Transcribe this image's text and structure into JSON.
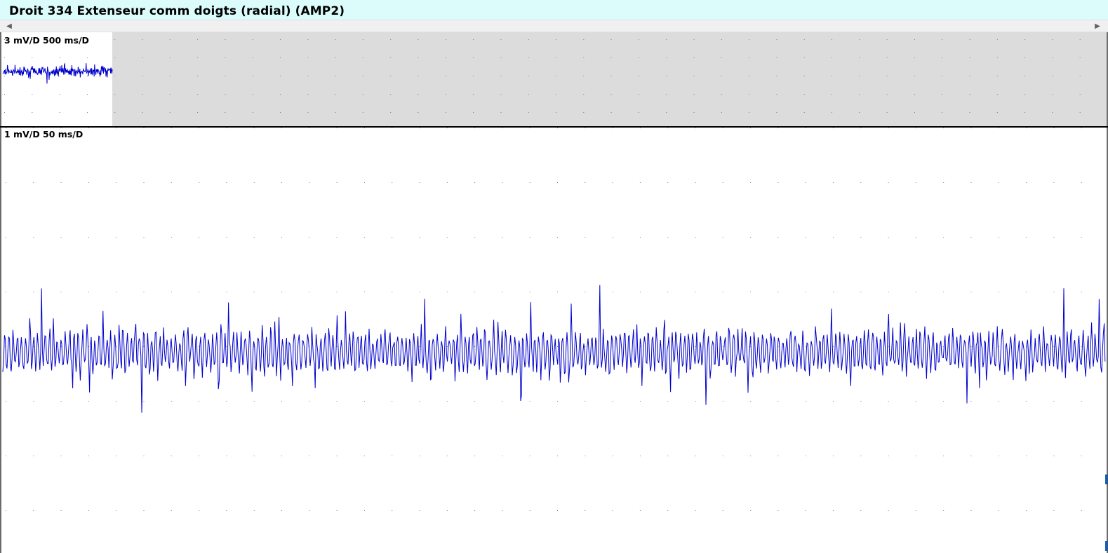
{
  "window": {
    "title": "Droit 334 Extenseur comm doigts (radial) (AMP2)"
  },
  "scrollbar": {
    "left_arrow": "◀",
    "right_arrow": "▶"
  },
  "panels": {
    "overview": {
      "scale_label": "3 mV/D 500 ms/D",
      "sensitivity_mv_per_div": 3,
      "sweep_ms_per_div": 500,
      "recorded_fraction_of_width": 0.1
    },
    "detail": {
      "scale_label": "1 mV/D 50 ms/D",
      "sensitivity_mv_per_div": 1,
      "sweep_ms_per_div": 50
    }
  },
  "colors": {
    "title_bg": "#dcfcfc",
    "trace": "#0000cc",
    "grid_dot": "#808080",
    "inactive_area": "#dcdcdc",
    "divider": "#000000",
    "edge_marker": "#1e5aa8"
  }
}
